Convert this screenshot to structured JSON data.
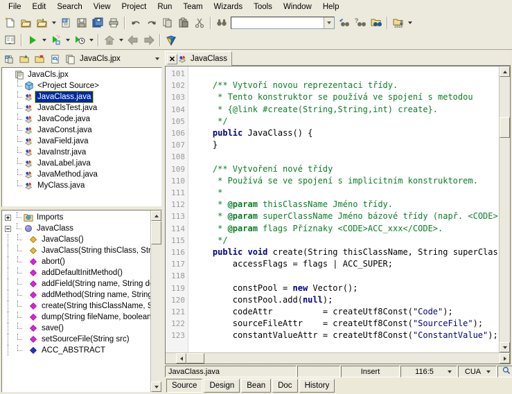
{
  "menubar": {
    "items": [
      "File",
      "Edit",
      "Search",
      "View",
      "Project",
      "Run",
      "Team",
      "Wizards",
      "Tools",
      "Window",
      "Help"
    ]
  },
  "toolbar": {
    "row1": [
      {
        "name": "new-file-button",
        "icon": "new-file-icon"
      },
      {
        "name": "open-project-button",
        "icon": "open-project-icon"
      },
      {
        "name": "open-file-button",
        "icon": "open-file-icon",
        "dropdown": true
      },
      {
        "name": "close-project-button",
        "icon": "close-project-icon"
      },
      {
        "name": "save-button",
        "icon": "save-disk-icon"
      },
      {
        "name": "save-all-button",
        "icon": "save-all-icon"
      },
      {
        "name": "print-button",
        "icon": "print-icon"
      },
      {
        "name": "undo-button",
        "icon": "undo-arrow-icon"
      },
      {
        "name": "redo-button",
        "icon": "redo-arrow-icon"
      },
      {
        "name": "copy-button",
        "icon": "copy-icon"
      },
      {
        "name": "paste-button",
        "icon": "paste-icon"
      },
      {
        "name": "cut-button",
        "icon": "scissors-icon"
      },
      {
        "name": "find-button",
        "icon": "binoculars-icon"
      }
    ],
    "row1_right": [
      {
        "name": "search-again-button",
        "icon": "search-again-icon"
      },
      {
        "name": "search-help-button",
        "icon": "search-help-icon"
      },
      {
        "name": "find-in-path-button",
        "icon": "find-in-folder-icon"
      },
      {
        "name": "browse-classes-button",
        "icon": "folder-classes-icon",
        "dropdown": true
      }
    ],
    "row2": [
      {
        "name": "make-project-button",
        "icon": "make-project-icon"
      },
      {
        "name": "run-button",
        "icon": "run-green-arrow-icon",
        "dropdown": true
      },
      {
        "name": "run-configuration-button",
        "icon": "run-config-icon",
        "dropdown": true
      },
      {
        "name": "debug-button",
        "icon": "debug-icon",
        "dropdown": true
      },
      {
        "name": "home-button",
        "icon": "home-icon",
        "dropdown": true
      },
      {
        "name": "back-button",
        "icon": "back-arrow-icon"
      },
      {
        "name": "forward-button",
        "icon": "forward-arrow-icon"
      },
      {
        "name": "help-button",
        "icon": "help-book-icon"
      }
    ],
    "search_value": "",
    "search_placeholder": ""
  },
  "project_pane": {
    "title": "JavaCls.jpx",
    "buttons": [
      {
        "name": "close-project-button",
        "icon": "close-project-icon"
      },
      {
        "name": "add-to-project-button",
        "icon": "add-file-icon"
      },
      {
        "name": "remove-from-project-button",
        "icon": "remove-file-icon"
      },
      {
        "name": "refresh-project-button",
        "icon": "refresh-icon"
      },
      {
        "name": "project-properties-button",
        "icon": "project-icon"
      }
    ],
    "tree": [
      {
        "label": "JavaCls.jpx",
        "icon": "project-icon",
        "depth": 0,
        "selected": false
      },
      {
        "label": "<Project Source>",
        "icon": "package-icon",
        "depth": 1,
        "selected": false
      },
      {
        "label": "JavaClass.java",
        "icon": "java-file-icon",
        "depth": 1,
        "selected": true
      },
      {
        "label": "JavaClsTest.java",
        "icon": "java-file-icon",
        "depth": 1,
        "selected": false
      },
      {
        "label": "JavaCode.java",
        "icon": "java-file-icon",
        "depth": 1,
        "selected": false
      },
      {
        "label": "JavaConst.java",
        "icon": "java-file-icon",
        "depth": 1,
        "selected": false
      },
      {
        "label": "JavaField.java",
        "icon": "java-file-icon",
        "depth": 1,
        "selected": false
      },
      {
        "label": "JavaInstr.java",
        "icon": "java-file-icon",
        "depth": 1,
        "selected": false
      },
      {
        "label": "JavaLabel.java",
        "icon": "java-file-icon",
        "depth": 1,
        "selected": false
      },
      {
        "label": "JavaMethod.java",
        "icon": "java-file-icon",
        "depth": 1,
        "selected": false
      },
      {
        "label": "MyClass.java",
        "icon": "java-file-icon",
        "depth": 1,
        "selected": false
      }
    ]
  },
  "structure_pane": {
    "tree": [
      {
        "label": "Imports",
        "icon": "imports-folder-icon",
        "depth": 0,
        "expander": "plus"
      },
      {
        "label": "JavaClass",
        "icon": "class-sphere-icon",
        "depth": 0,
        "expander": "minus"
      },
      {
        "label": "JavaClass()",
        "icon": "constructor-diamond-icon",
        "depth": 1,
        "expander": ""
      },
      {
        "label": "JavaClass(String thisClass, Stri",
        "icon": "constructor-diamond-icon",
        "depth": 1,
        "expander": ""
      },
      {
        "label": "abort()",
        "icon": "method-diamond-icon",
        "depth": 1,
        "expander": ""
      },
      {
        "label": "addDefaultInitMethod()",
        "icon": "method-diamond-icon",
        "depth": 1,
        "expander": ""
      },
      {
        "label": "addField(String name, String de",
        "icon": "method-diamond-icon",
        "depth": 1,
        "expander": ""
      },
      {
        "label": "addMethod(String name, String",
        "icon": "method-diamond-icon",
        "depth": 1,
        "expander": ""
      },
      {
        "label": "create(String thisClassName, St",
        "icon": "method-diamond-icon",
        "depth": 1,
        "expander": ""
      },
      {
        "label": "dump(String fileName, boolean",
        "icon": "method-diamond-icon",
        "depth": 1,
        "expander": ""
      },
      {
        "label": "save()",
        "icon": "method-diamond-icon",
        "depth": 1,
        "expander": ""
      },
      {
        "label": "setSourceFile(String src)",
        "icon": "method-diamond-icon",
        "depth": 1,
        "expander": ""
      },
      {
        "label": "ACC_ABSTRACT",
        "icon": "field-diamond-icon",
        "depth": 1,
        "expander": ""
      }
    ]
  },
  "editor": {
    "tab": {
      "label": "JavaClass",
      "close_label": "✕",
      "icon": "java-file-icon"
    },
    "first_line": 101,
    "lines": [
      {
        "n": 101,
        "tokens": []
      },
      {
        "n": 102,
        "tokens": [
          {
            "t": "    ",
            "c": "pl"
          },
          {
            "t": "/** Vytvoří novou reprezentaci třídy.",
            "c": "cm"
          }
        ]
      },
      {
        "n": 103,
        "tokens": [
          {
            "t": "     ",
            "c": "pl"
          },
          {
            "t": "* Tento konstruktor se používá ve spojení s metodou",
            "c": "cm"
          }
        ]
      },
      {
        "n": 104,
        "tokens": [
          {
            "t": "     ",
            "c": "pl"
          },
          {
            "t": "* {@link #create(String,String,int) create}.",
            "c": "cm"
          }
        ]
      },
      {
        "n": 105,
        "tokens": [
          {
            "t": "     ",
            "c": "pl"
          },
          {
            "t": "*/",
            "c": "cm"
          }
        ]
      },
      {
        "n": 106,
        "tokens": [
          {
            "t": "    ",
            "c": "pl"
          },
          {
            "t": "public",
            "c": "kw"
          },
          {
            "t": " JavaClass() {",
            "c": "pl"
          }
        ]
      },
      {
        "n": 107,
        "tokens": [
          {
            "t": "    }",
            "c": "pl"
          }
        ]
      },
      {
        "n": 108,
        "tokens": []
      },
      {
        "n": 109,
        "tokens": [
          {
            "t": "    ",
            "c": "pl"
          },
          {
            "t": "/** Vytvoření nové třídy",
            "c": "cm"
          }
        ]
      },
      {
        "n": 110,
        "tokens": [
          {
            "t": "     ",
            "c": "pl"
          },
          {
            "t": "* Používá se ve spojení s implicitním konstruktorem.",
            "c": "cm"
          }
        ]
      },
      {
        "n": 111,
        "tokens": [
          {
            "t": "     ",
            "c": "pl"
          },
          {
            "t": "*",
            "c": "cm"
          }
        ]
      },
      {
        "n": 112,
        "tokens": [
          {
            "t": "     ",
            "c": "pl"
          },
          {
            "t": "* ",
            "c": "cm"
          },
          {
            "t": "@param",
            "c": "cmb"
          },
          {
            "t": " thisClassName Jméno třídy.",
            "c": "cm"
          }
        ]
      },
      {
        "n": 113,
        "tokens": [
          {
            "t": "     ",
            "c": "pl"
          },
          {
            "t": "* ",
            "c": "cm"
          },
          {
            "t": "@param",
            "c": "cmb"
          },
          {
            "t": " superClassName Jméno bázové třídy (např. <CODE>",
            "c": "cm"
          }
        ]
      },
      {
        "n": 114,
        "tokens": [
          {
            "t": "     ",
            "c": "pl"
          },
          {
            "t": "* ",
            "c": "cm"
          },
          {
            "t": "@param",
            "c": "cmb"
          },
          {
            "t": " flags Příznaky <CODE>ACC_xxx</CODE>.",
            "c": "cm"
          }
        ]
      },
      {
        "n": 115,
        "tokens": [
          {
            "t": "     ",
            "c": "pl"
          },
          {
            "t": "*/",
            "c": "cm"
          }
        ]
      },
      {
        "n": 116,
        "tokens": [
          {
            "t": "    ",
            "c": "pl"
          },
          {
            "t": "public void",
            "c": "kw"
          },
          {
            "t": " create(String thisClassName, String superClas",
            "c": "pl"
          }
        ]
      },
      {
        "n": 117,
        "tokens": [
          {
            "t": "        accessFlags = flags | ACC_SUPER;",
            "c": "pl"
          }
        ]
      },
      {
        "n": 118,
        "tokens": []
      },
      {
        "n": 119,
        "tokens": [
          {
            "t": "        constPool = ",
            "c": "pl"
          },
          {
            "t": "new",
            "c": "kw"
          },
          {
            "t": " Vector();",
            "c": "pl"
          }
        ]
      },
      {
        "n": 120,
        "tokens": [
          {
            "t": "        constPool.add(",
            "c": "pl"
          },
          {
            "t": "null",
            "c": "kw"
          },
          {
            "t": ");",
            "c": "pl"
          }
        ]
      },
      {
        "n": 121,
        "tokens": [
          {
            "t": "        codeAttr          = createUtf8Const(",
            "c": "pl"
          },
          {
            "t": "\"Code\"",
            "c": "st"
          },
          {
            "t": ");",
            "c": "pl"
          }
        ]
      },
      {
        "n": 122,
        "tokens": [
          {
            "t": "        sourceFileAttr    = createUtf8Const(",
            "c": "pl"
          },
          {
            "t": "\"SourceFile\"",
            "c": "st"
          },
          {
            "t": ");",
            "c": "pl"
          }
        ]
      },
      {
        "n": 123,
        "tokens": [
          {
            "t": "        constantValueAttr = createUtf8Const(",
            "c": "pl"
          },
          {
            "t": "\"ConstantValue\"",
            "c": "st"
          },
          {
            "t": ");",
            "c": "pl"
          }
        ]
      }
    ]
  },
  "statusbar": {
    "file": "JavaClass.java",
    "message": "",
    "insert_mode": "Insert",
    "caret": "116:5",
    "keymap": "CUA",
    "zoom_icon": "magnifier-icon"
  },
  "bottom_tabs": [
    {
      "label": "Source",
      "active": true
    },
    {
      "label": "Design",
      "active": false
    },
    {
      "label": "Bean",
      "active": false
    },
    {
      "label": "Doc",
      "active": false
    },
    {
      "label": "History",
      "active": false
    }
  ],
  "colors": {
    "comment": "#0a7d25",
    "keyword": "#00007f",
    "string": "#00007f",
    "selection_bg": "#00299c",
    "selection_border": "#c0d000",
    "chrome": "#ece9dd"
  }
}
